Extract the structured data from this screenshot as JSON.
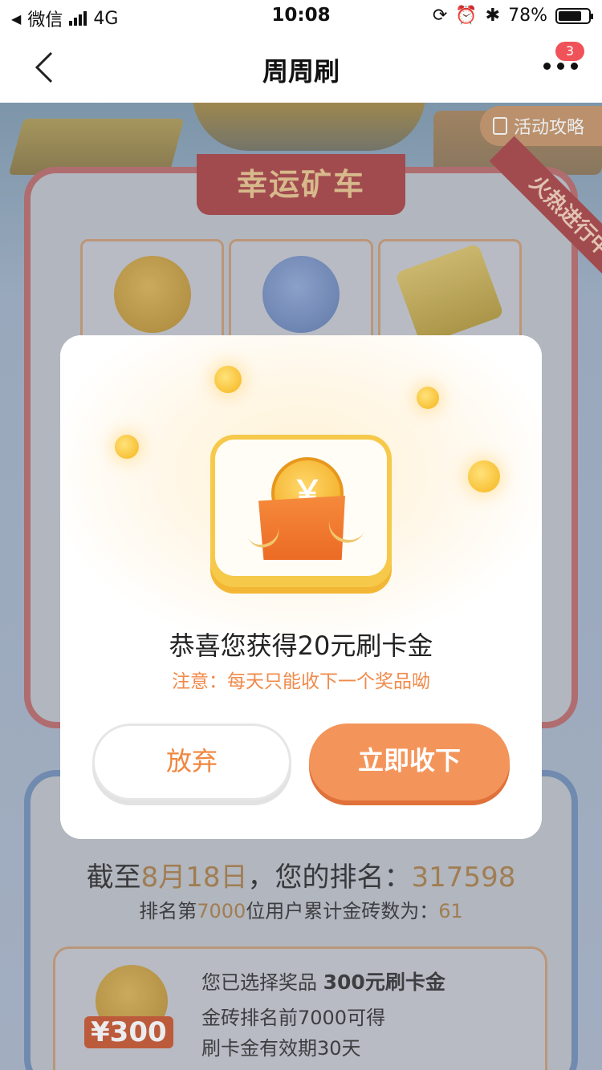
{
  "status_bar": {
    "carrier": "微信",
    "network": "4G",
    "time": "10:08",
    "battery": "78%"
  },
  "nav": {
    "title": "周周刷",
    "badge_count": "3"
  },
  "background": {
    "guide_button": "活动攻略",
    "card_title": "幸运矿车",
    "ribbon": "火热进行中",
    "rank_prefix": "截至",
    "rank_date": "8月18日",
    "rank_mid": "，您的排名：",
    "rank_value": "317598",
    "rank2_prefix": "排名第",
    "rank2_pos": "7000",
    "rank2_mid": "位用户累计金砖数为：",
    "rank2_value": "61",
    "prize_prefix": "您已选择奖品",
    "prize_name": "300元刷卡金",
    "prize_line2": "金砖排名前7000可得",
    "prize_line3": "刷卡金有效期30天",
    "prize_amount": "¥300"
  },
  "modal": {
    "coin_symbol": "￥",
    "title": "恭喜您获得20元刷卡金",
    "note": "注意：每天只能收下一个奖品呦",
    "give_up_label": "放弃",
    "accept_label": "立即收下"
  },
  "colors": {
    "accent_orange": "#f3955b",
    "note_orange": "#f08a4a",
    "badge_red": "#f0525a",
    "gold": "#f6c94a"
  }
}
